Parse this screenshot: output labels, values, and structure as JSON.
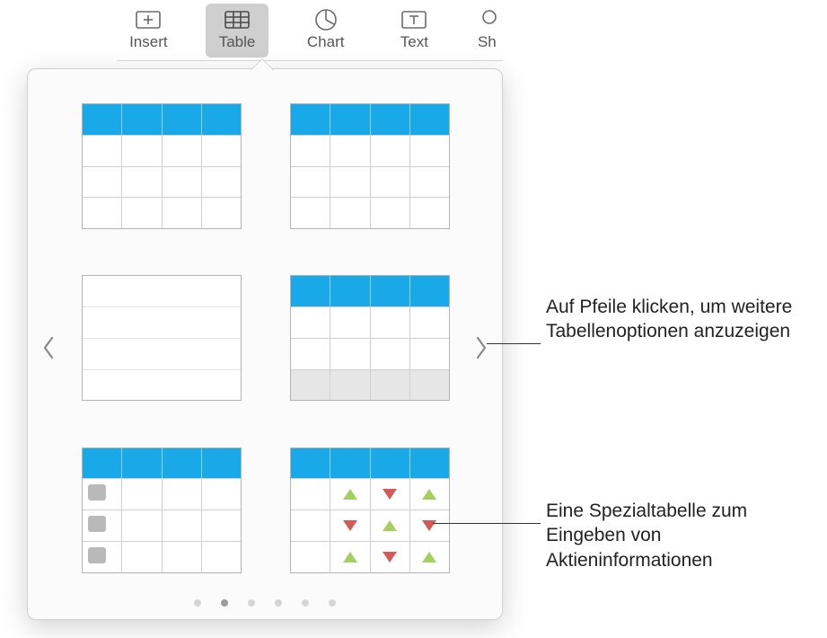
{
  "toolbar": {
    "items": [
      {
        "id": "insert",
        "label": "Insert"
      },
      {
        "id": "table",
        "label": "Table"
      },
      {
        "id": "chart",
        "label": "Chart"
      },
      {
        "id": "text",
        "label": "Text"
      },
      {
        "id": "shape",
        "label": "Sh"
      }
    ],
    "active": "table"
  },
  "popover": {
    "page_count": 6,
    "current_page": 2,
    "options": [
      {
        "id": "blue-header-4col"
      },
      {
        "id": "blue-header-4col-b"
      },
      {
        "id": "plain-grid"
      },
      {
        "id": "header-footer"
      },
      {
        "id": "tagged-rows"
      },
      {
        "id": "stock-arrows"
      }
    ]
  },
  "annotations": {
    "arrows": "Auf Pfeile klicken, um weitere Tabellenoptionen anzuzeigen",
    "stock": "Eine Spezialtabelle zum Eingeben von Aktieninformationen"
  }
}
